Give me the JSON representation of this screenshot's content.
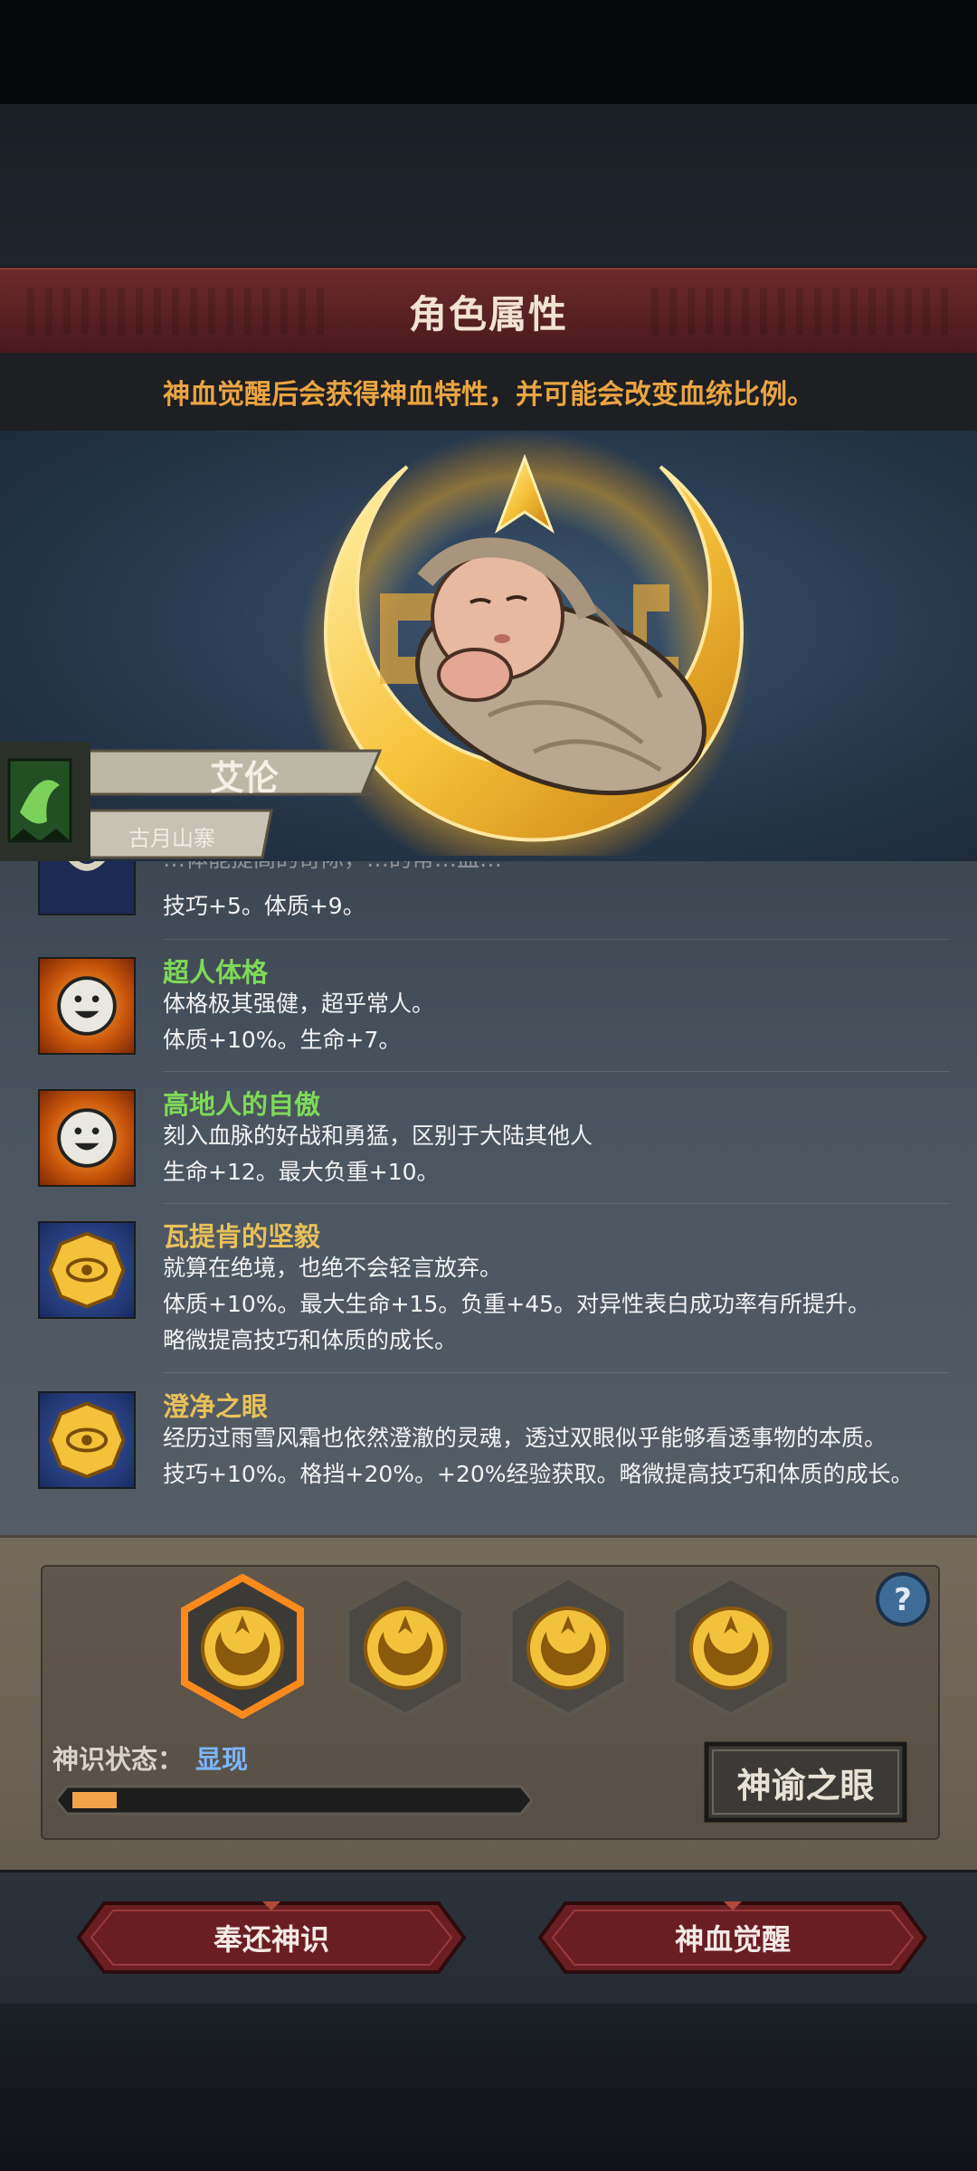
{
  "header": {
    "title": "角色属性",
    "hint": "神血觉醒后会获得神血特性，并可能会改变血统比例。"
  },
  "character": {
    "name": "艾伦",
    "clan": "古月山寨",
    "flag_icon": "green-banner-icon",
    "portrait": "swaddled-baby-portrait"
  },
  "traits": [
    {
      "name": "",
      "name_color": "#7ed957",
      "icon": "blue-spirit-icon",
      "description": "技巧+5。体质+9。",
      "partial_top_line": "…体能提高的奇际，…的常…血…"
    },
    {
      "name": "超人体格",
      "name_color": "#7ed957",
      "icon": "smiling-face-icon",
      "description": "体格极其强健，超乎常人。\n体质+10%。生命+7。"
    },
    {
      "name": "高地人的自傲",
      "name_color": "#7ed957",
      "icon": "smiling-face-icon",
      "description": "刻入血脉的好战和勇猛，区别于大陆其他人\n生命+12。最大负重+10。"
    },
    {
      "name": "瓦提肯的坚毅",
      "name_color": "#e8c15a",
      "icon": "golden-eye-seal-icon",
      "description": "就算在绝境，也绝不会轻言放弃。\n体质+10%。最大生命+15。负重+45。对异性表白成功率有所提升。\n略微提高技巧和体质的成长。"
    },
    {
      "name": "澄净之眼",
      "name_color": "#e8c15a",
      "icon": "golden-eye-seal-icon",
      "description": "经历过雨雪风霜也依然澄澈的灵魂，透过双眼似乎能够看透事物的本质。\n技巧+10%。格挡+20%。+20%经验获取。略微提高技巧和体质的成长。"
    }
  ],
  "godsense": {
    "slots": [
      {
        "icon": "golden-crescent-emblem-icon",
        "selected": true
      },
      {
        "icon": "golden-crescent-emblem-icon",
        "selected": false
      },
      {
        "icon": "golden-crescent-emblem-icon",
        "selected": false
      },
      {
        "icon": "golden-crescent-emblem-icon",
        "selected": false
      }
    ],
    "status_label": "神识状态：",
    "status_value": "显现",
    "progress": 0.1,
    "oracle_button": "神谕之眼",
    "help_icon": "question-mark-icon"
  },
  "actions": {
    "return_button": "奉还神识",
    "awaken_button": "神血觉醒"
  },
  "colors": {
    "title_red": "#5a2224",
    "hint_orange": "#e9a443",
    "status_blue": "#7cb6ff",
    "progress_orange": "#f2a24a"
  }
}
